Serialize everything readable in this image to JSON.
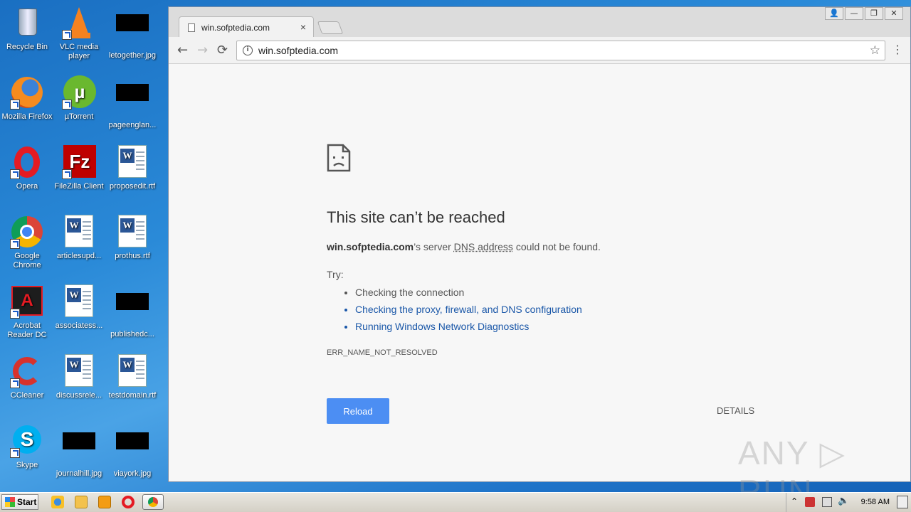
{
  "desktop": {
    "icons": [
      {
        "label": "Recycle Bin"
      },
      {
        "label": "VLC media player"
      },
      {
        "label": "letogether.jpg"
      },
      {
        "label": "Mozilla Firefox"
      },
      {
        "label": "µTorrent"
      },
      {
        "label": "pageenglan..."
      },
      {
        "label": "Opera"
      },
      {
        "label": "FileZilla Client"
      },
      {
        "label": "proposedit.rtf"
      },
      {
        "label": "Google Chrome"
      },
      {
        "label": "articlesupd..."
      },
      {
        "label": "prothus.rtf"
      },
      {
        "label": "Acrobat Reader DC"
      },
      {
        "label": "associatess..."
      },
      {
        "label": "publishedc..."
      },
      {
        "label": "CCleaner"
      },
      {
        "label": "discussrele..."
      },
      {
        "label": "testdomain.rtf"
      },
      {
        "label": "Skype"
      },
      {
        "label": "journalhill.jpg"
      },
      {
        "label": "viayork.jpg"
      }
    ]
  },
  "browser": {
    "tab_title": "win.sofptedia.com",
    "tab_close": "×",
    "url": "win.sofptedia.com",
    "back": "←",
    "forward": "→",
    "refresh": "⟳",
    "star": "☆",
    "menu": "⋮",
    "win_controls": {
      "user": "👤",
      "minimize": "—",
      "restore": "❐",
      "close": "✕"
    }
  },
  "error": {
    "title": "This site can’t be reached",
    "host": "win.sofptedia.com",
    "msg_mid": "’s server ",
    "msg_dns": "DNS address",
    "msg_end": " could not be found.",
    "try_label": "Try:",
    "suggestions": [
      "Checking the connection",
      "Checking the proxy, firewall, and DNS configuration",
      "Running Windows Network Diagnostics"
    ],
    "code": "ERR_NAME_NOT_RESOLVED",
    "reload_label": "Reload",
    "details_label": "DETAILS"
  },
  "watermark": "ANY ▷ RUN",
  "taskbar": {
    "start_label": "Start",
    "clock": "9:58 AM"
  }
}
